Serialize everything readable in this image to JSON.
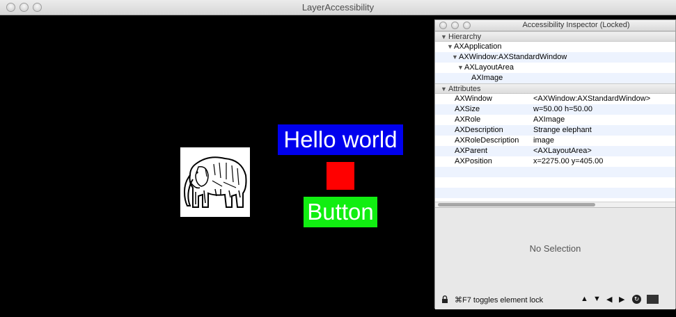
{
  "window": {
    "title": "LayerAccessibility"
  },
  "content": {
    "hello_text": "Hello world",
    "button_label": "Button",
    "image_alt": "Strange elephant"
  },
  "inspector": {
    "title": "Accessibility Inspector (Locked)",
    "hierarchy_header": "Hierarchy",
    "hierarchy": [
      {
        "label": "AXApplication"
      },
      {
        "label": "AXWindow:AXStandardWindow"
      },
      {
        "label": "AXLayoutArea"
      },
      {
        "label": "AXImage"
      }
    ],
    "attributes_header": "Attributes",
    "attributes": [
      {
        "name": "AXWindow",
        "value": "<AXWindow:AXStandardWindow>"
      },
      {
        "name": "AXSize",
        "value": "w=50.00 h=50.00"
      },
      {
        "name": "AXRole",
        "value": "AXImage"
      },
      {
        "name": "AXDescription",
        "value": "Strange elephant"
      },
      {
        "name": "AXRoleDescription",
        "value": "image"
      },
      {
        "name": "AXParent",
        "value": "<AXLayoutArea>"
      },
      {
        "name": "AXPosition",
        "value": "x=2275.00 y=405.00"
      }
    ],
    "no_selection": "No Selection",
    "lock_hint": "⌘F7 toggles element lock",
    "nav_up": "▲",
    "nav_down": "▼",
    "nav_left": "◀",
    "nav_right": "▶"
  },
  "colors": {
    "hello_bg": "#0000ee",
    "red_box": "#ff0000",
    "button_bg": "#11ee11"
  }
}
